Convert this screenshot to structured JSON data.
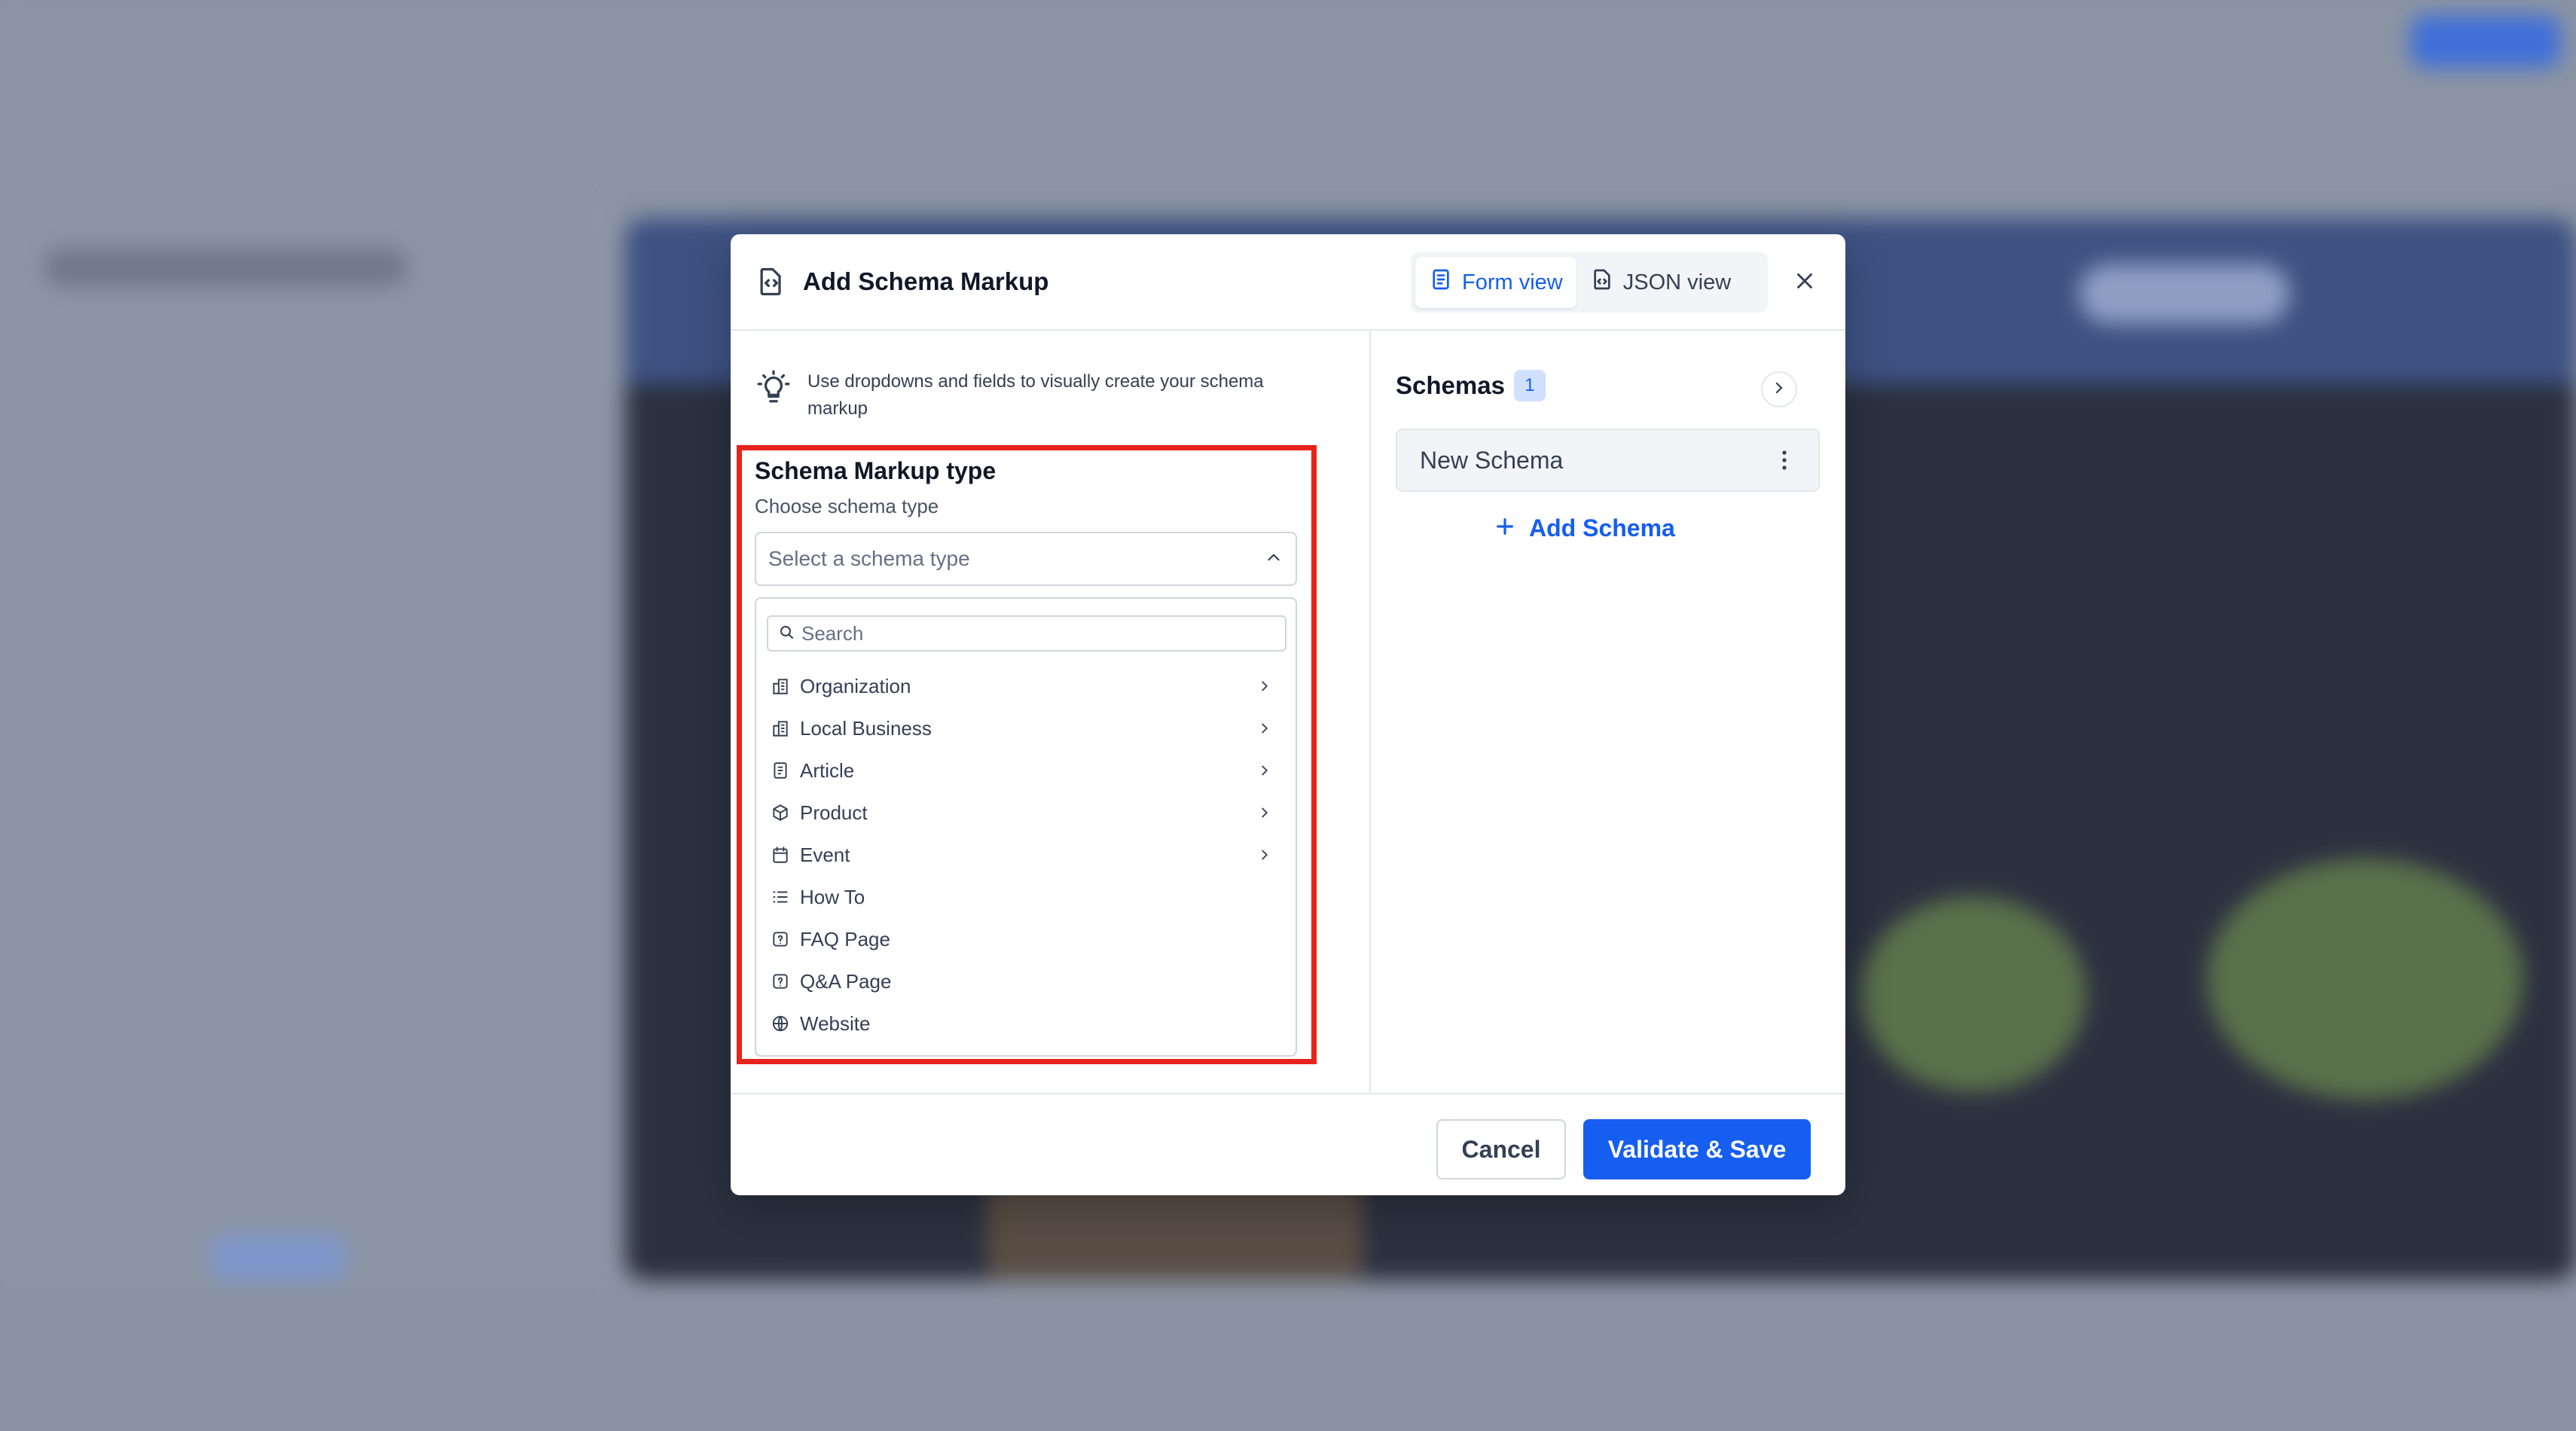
{
  "modal": {
    "title": "Add Schema Markup",
    "views": {
      "form_label": "Form view",
      "json_label": "JSON view",
      "active": "form"
    }
  },
  "hint": {
    "text": "Use dropdowns and fields to visually create your schema markup"
  },
  "schema_type": {
    "title": "Schema Markup type",
    "subtitle": "Choose schema type",
    "placeholder": "Select a schema type",
    "search_placeholder": "Search",
    "options": [
      {
        "label": "Organization",
        "icon": "building-icon",
        "has_submenu": true
      },
      {
        "label": "Local Business",
        "icon": "building-icon",
        "has_submenu": true
      },
      {
        "label": "Article",
        "icon": "document-icon",
        "has_submenu": true
      },
      {
        "label": "Product",
        "icon": "cube-icon",
        "has_submenu": true
      },
      {
        "label": "Event",
        "icon": "calendar-icon",
        "has_submenu": true
      },
      {
        "label": "How To",
        "icon": "list-icon",
        "has_submenu": false
      },
      {
        "label": "FAQ Page",
        "icon": "question-icon",
        "has_submenu": false
      },
      {
        "label": "Q&A Page",
        "icon": "question-icon",
        "has_submenu": false
      },
      {
        "label": "Website",
        "icon": "globe-icon",
        "has_submenu": false
      }
    ]
  },
  "schemas": {
    "title": "Schemas",
    "count": "1",
    "items": [
      {
        "label": "New Schema"
      }
    ],
    "add_label": "Add Schema"
  },
  "footer": {
    "cancel_label": "Cancel",
    "save_label": "Validate & Save"
  },
  "colors": {
    "accent": "#155eef",
    "highlight": "#e8231c"
  }
}
